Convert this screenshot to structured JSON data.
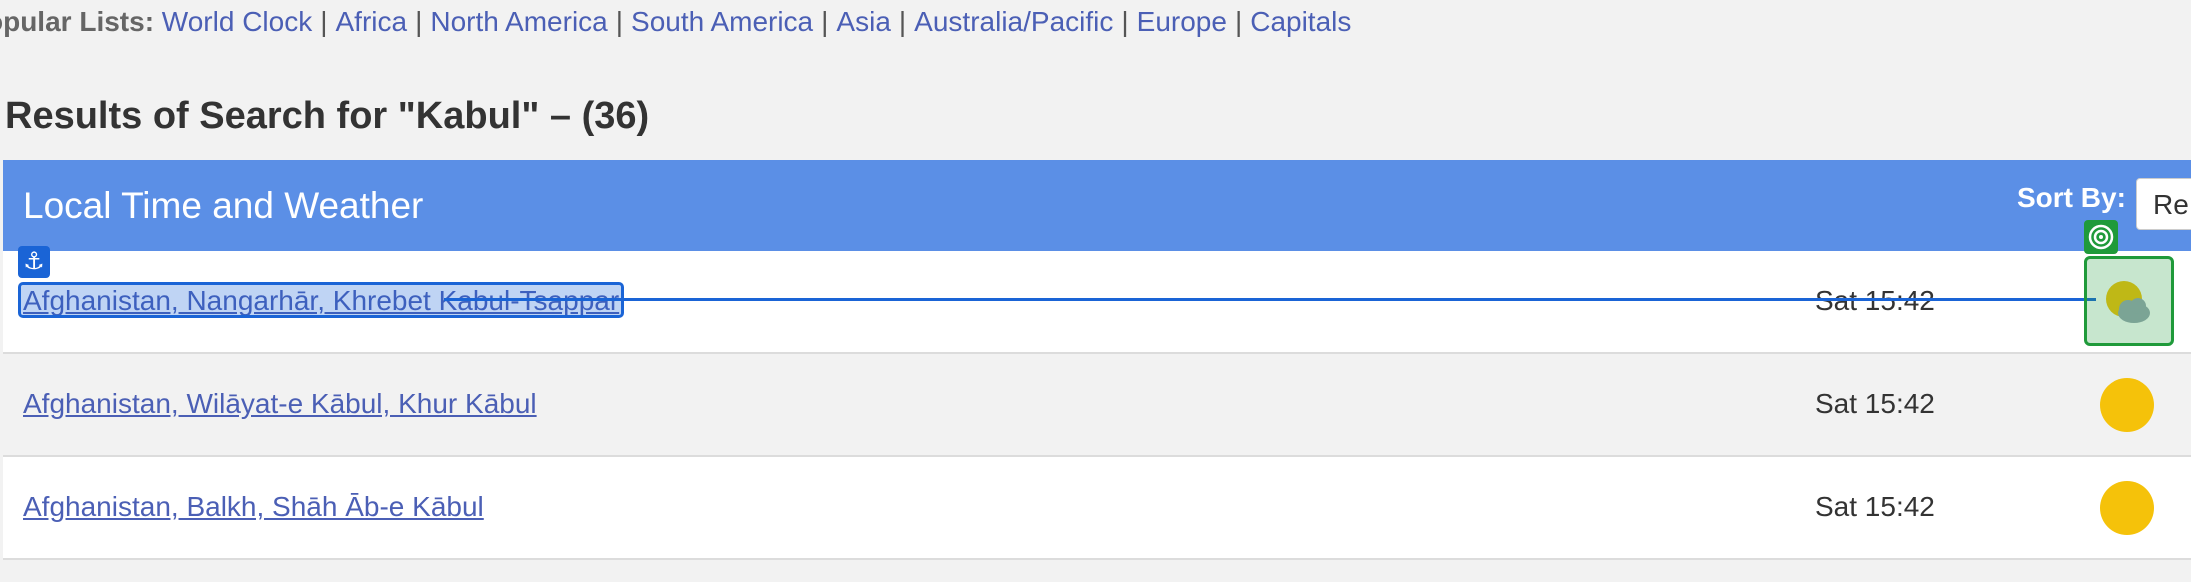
{
  "popular": {
    "lead": "opular Lists:",
    "links": [
      "World Clock",
      "Africa",
      "North America",
      "South America",
      "Asia",
      "Australia/Pacific",
      "Europe",
      "Capitals"
    ],
    "separator": "|"
  },
  "results": {
    "title": "Results of Search for \"Kabul\" – (36)"
  },
  "table": {
    "heading": "Local Time and Weather",
    "sort_label": "Sort By:",
    "sort_value": "Re",
    "rows": [
      {
        "place": "Afghanistan, Nangarhār, Khrebet Kabul-Tsappar",
        "time": "Sat 15:42",
        "weather_icon": "partly-cloudy-icon"
      },
      {
        "place": "Afghanistan, Wilāyat-e Kābul, Khur Kābul",
        "time": "Sat 15:42",
        "weather_icon": "sun-icon"
      },
      {
        "place": "Afghanistan, Balkh, Shāh Āb-e Kābul",
        "time": "Sat 15:42",
        "weather_icon": "sun-icon"
      }
    ]
  },
  "overlay": {
    "anchor_icon": "anchor-icon",
    "target_icon": "target-icon",
    "highlight_color": "#1a64d6",
    "target_color": "#1f9a3a"
  },
  "colors": {
    "header_bg": "#5b8fe6",
    "link": "#4b5fb5",
    "sun": "#f5c20a"
  }
}
